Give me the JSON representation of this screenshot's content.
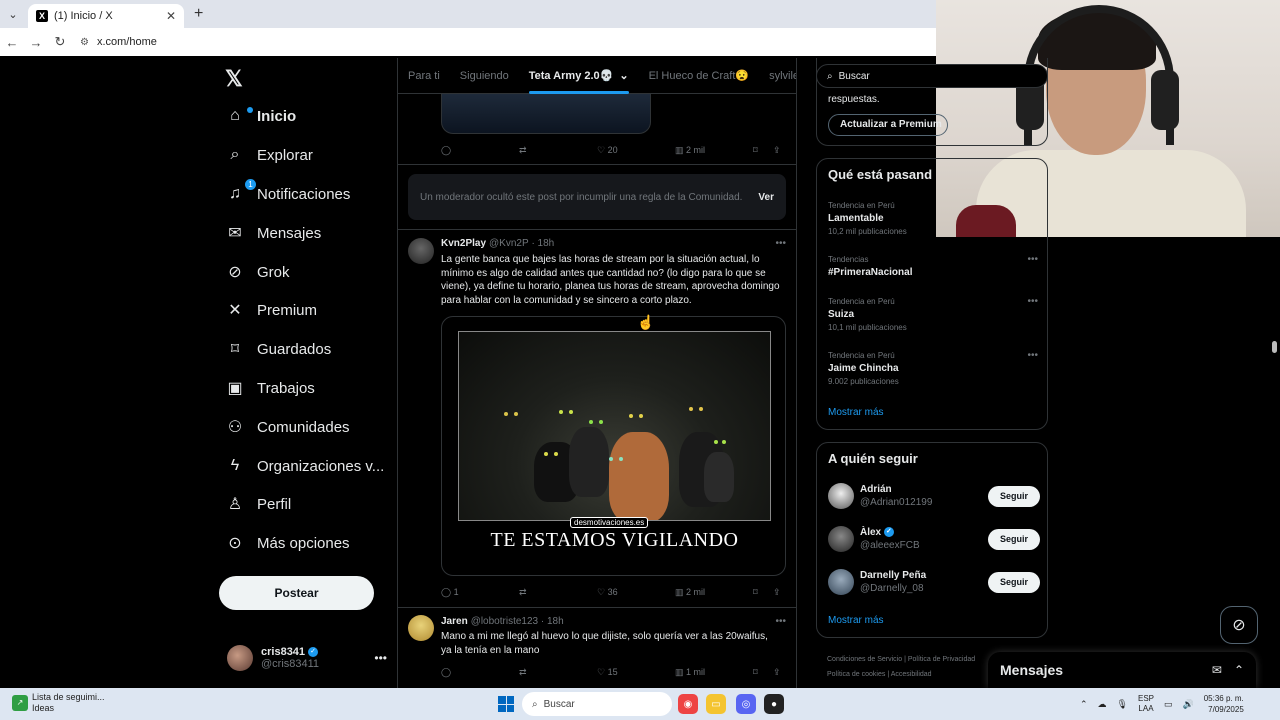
{
  "browser": {
    "tab_title": "(1) Inicio / X",
    "url": "x.com/home"
  },
  "nav": {
    "items": [
      {
        "label": "Inicio",
        "icon": "home-icon"
      },
      {
        "label": "Explorar",
        "icon": "search-icon"
      },
      {
        "label": "Notificaciones",
        "icon": "bell-icon",
        "badge": "1"
      },
      {
        "label": "Mensajes",
        "icon": "envelope-icon"
      },
      {
        "label": "Grok",
        "icon": "grok-icon"
      },
      {
        "label": "Premium",
        "icon": "x-logo-icon"
      },
      {
        "label": "Guardados",
        "icon": "bookmark-icon"
      },
      {
        "label": "Trabajos",
        "icon": "briefcase-icon"
      },
      {
        "label": "Comunidades",
        "icon": "people-icon"
      },
      {
        "label": "Organizaciones v...",
        "icon": "bolt-icon"
      },
      {
        "label": "Perfil",
        "icon": "person-icon"
      },
      {
        "label": "Más opciones",
        "icon": "more-circle-icon"
      }
    ],
    "post_button": "Postear",
    "account": {
      "name": "cris8341",
      "handle": "@cris83411"
    }
  },
  "feed": {
    "tabs": [
      "Para ti",
      "Siguiendo",
      "Teta Army 2.0💀",
      "El Hueco de Craft😧",
      "sylvile"
    ],
    "active_tab": "Teta Army 2.0💀",
    "first_post_stats": {
      "replies": "",
      "reposts": "",
      "likes": "20",
      "views": "2 mil"
    },
    "hidden_post": {
      "message": "Un moderador ocultó este post por incumplir una regla de la Comunidad.",
      "action": "Ver"
    },
    "post2": {
      "name": "Kvn2Play",
      "handle": "@Kvn2P",
      "time": "· 18h",
      "text": "La gente banca que bajes las horas de stream por la situación actual, lo mínimo es algo de calidad antes que cantidad no? (lo digo para lo que se viene), ya define tu horario, planea tus horas de stream, aprovecha domingo para hablar con la comunidad y se sincero a corto plazo.",
      "meme_brand": "desmotivaciones.es",
      "meme_caption": "TE ESTAMOS VIGILANDO",
      "stats": {
        "replies": "1",
        "reposts": "",
        "likes": "36",
        "views": "2 mil"
      }
    },
    "post3": {
      "name": "Jaren",
      "handle": "@lobotriste123",
      "time": "· 18h",
      "text": "Mano a mi me llegó al huevo lo que dijiste, solo quería ver a las 20waifus, ya la tenía en la mano",
      "stats": {
        "replies": "",
        "reposts": "",
        "likes": "15",
        "views": "1 mil"
      }
    }
  },
  "right": {
    "search_placeholder": "Buscar",
    "premium_text": "respuestas.",
    "premium_button": "Actualizar a Premium",
    "trends_title": "Qué está pasand",
    "trends": [
      {
        "context": "Tendencia en Perú",
        "name": "Lamentable",
        "count": "10,2 mil publicaciones"
      },
      {
        "context": "Tendencias",
        "name": "#PrimeraNacional",
        "count": ""
      },
      {
        "context": "Tendencia en Perú",
        "name": "Suiza",
        "count": "10,1 mil publicaciones"
      },
      {
        "context": "Tendencia en Perú",
        "name": "Jaime Chincha",
        "count": "9.002 publicaciones"
      }
    ],
    "show_more": "Mostrar más",
    "follow_title": "A quién seguir",
    "follow": [
      {
        "name": "Adrián",
        "handle": "@Adrian012199",
        "verified": false
      },
      {
        "name": "Àlex",
        "handle": "@aleeexFCB",
        "verified": true
      },
      {
        "name": "Darnelly Peña",
        "handle": "@Darnelly_08",
        "verified": false
      }
    ],
    "follow_button": "Seguir",
    "footer": [
      "Condiciones de Servicio",
      "|",
      "Política de Privacidad",
      "Política de cookies",
      "|",
      "Accesibilidad"
    ]
  },
  "messages_drawer": {
    "title": "Mensajes"
  },
  "taskbar": {
    "widget_title": "Lista de seguimi...",
    "widget_sub": "Ideas",
    "search": "Buscar",
    "lang1": "ESP",
    "lang2": "LAA",
    "time": "05:36 p. m.",
    "date": "7/09/2025"
  },
  "colors": {
    "accent": "#1d9bf0",
    "bg": "#000000",
    "border": "#2f3336",
    "muted": "#71767b"
  }
}
